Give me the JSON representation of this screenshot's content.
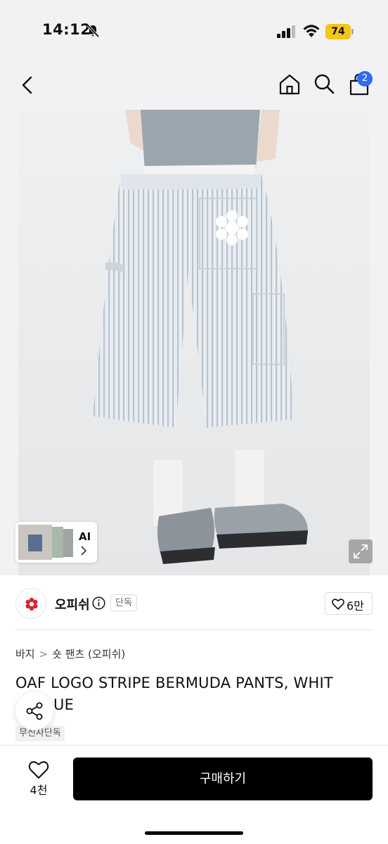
{
  "status_bar": {
    "time": "14:12",
    "battery": "74",
    "battery_color": "#f5c518"
  },
  "nav": {
    "icons": [
      "back-icon",
      "home-icon",
      "search-icon",
      "cart-icon"
    ],
    "cart_count": "2",
    "badge_color": "#2d6cf6"
  },
  "gallery": {
    "ai_label": "AI"
  },
  "brand": {
    "name": "오피쉬",
    "exclusive_badge": "단독",
    "like_count": "6만"
  },
  "product": {
    "breadcrumb": [
      "바지",
      "숏 팬츠 (오피쉬)"
    ],
    "title_line1": "OAF LOGO STRIPE BERMUDA PANTS, WHIT",
    "title_line2": "UE",
    "tag": "무신사단독"
  },
  "bottom": {
    "wish_count": "4천",
    "buy_label": "구매하기"
  }
}
